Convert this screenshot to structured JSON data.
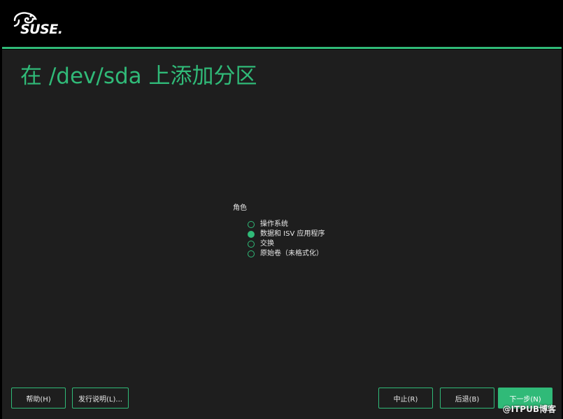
{
  "brand": {
    "name": "SUSE."
  },
  "page": {
    "title": "在 /dev/sda 上添加分区"
  },
  "roles": {
    "label": "角色",
    "options": [
      {
        "label": "操作系统",
        "checked": false
      },
      {
        "label": "数据和 ISV 应用程序",
        "checked": true
      },
      {
        "label": "交换",
        "checked": false
      },
      {
        "label": "原始卷（未格式化）",
        "checked": false
      }
    ]
  },
  "buttons": {
    "help": "帮助(H)",
    "release_notes": "发行说明(L)...",
    "abort": "中止(R)",
    "back": "后退(B)",
    "next": "下一步(N)"
  },
  "watermark": "@ITPUB博客",
  "colors": {
    "accent": "#30ba78",
    "background": "#1e1e1e",
    "header": "#000000"
  }
}
